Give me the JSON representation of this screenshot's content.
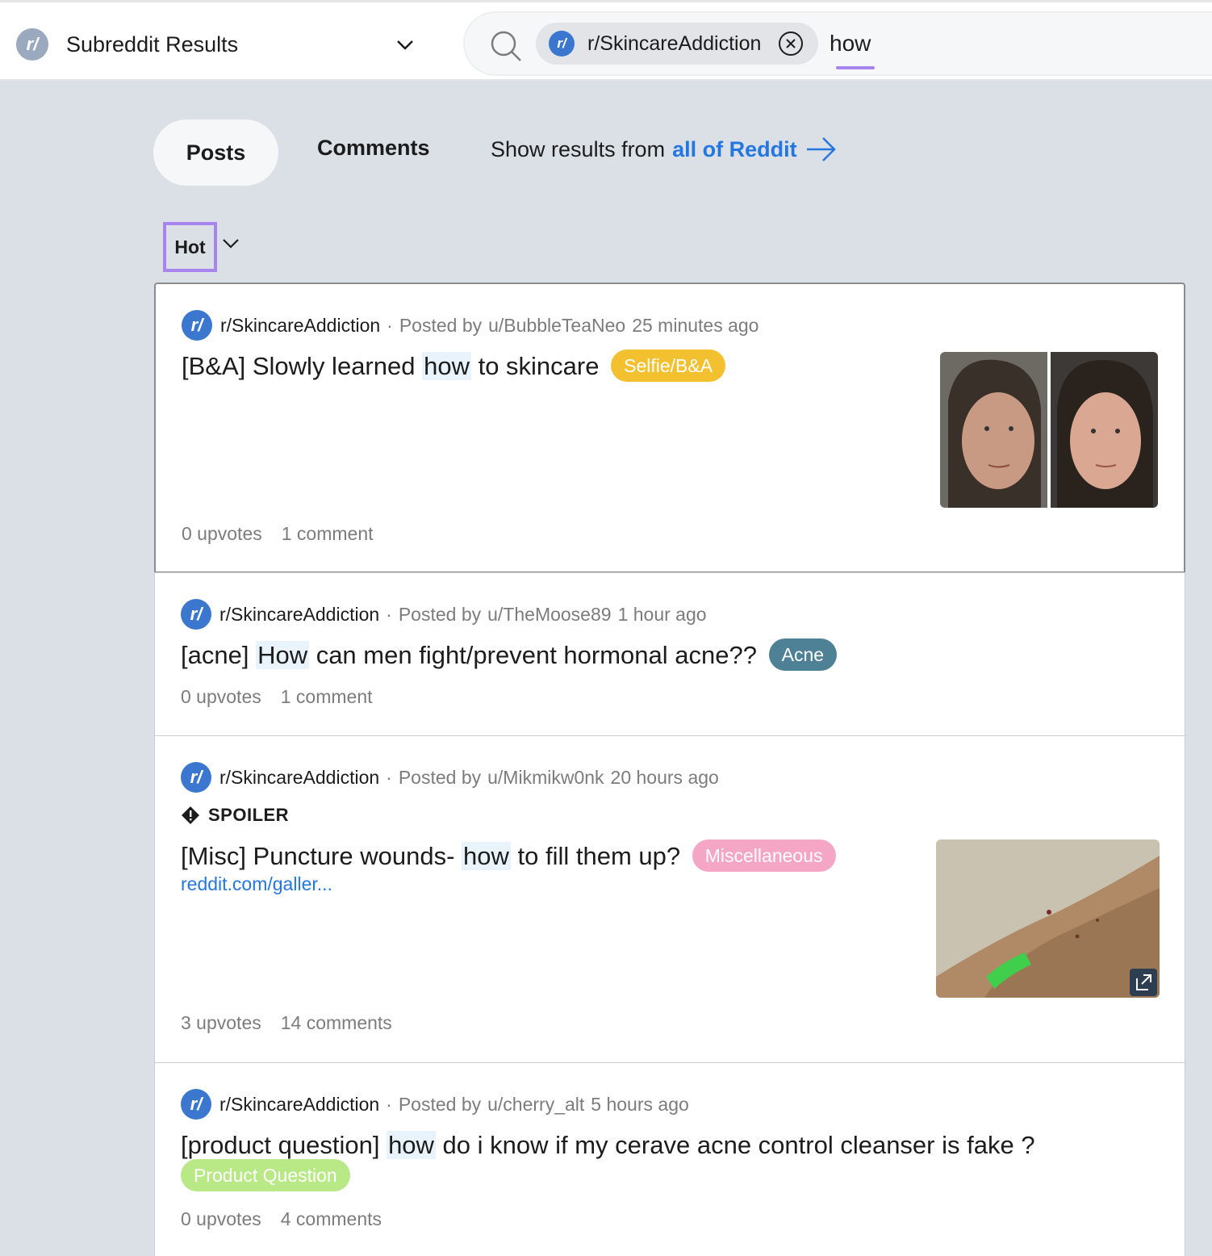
{
  "header": {
    "community_icon_text": "r/",
    "community_title": "Subreddit Results",
    "chip_icon_text": "r/",
    "chip_label": "r/SkincareAddiction",
    "search_value": "how"
  },
  "tabs": {
    "posts": "Posts",
    "comments": "Comments",
    "show_results_prefix": "Show results from",
    "show_results_link": "all of Reddit"
  },
  "sort": {
    "label": "Hot"
  },
  "posts": [
    {
      "subreddit": "r/SkincareAddiction",
      "posted_by": "Posted by",
      "user": "u/BubbleTeaNeo",
      "time": "25 minutes ago",
      "title_before": "[B&A] Slowly learned ",
      "title_highlight": "how",
      "title_after": " to skincare",
      "flair": "Selfie/B&A",
      "flair_bg": "#f3c12f",
      "flair_color": "#ffffff",
      "upvotes": "0 upvotes",
      "comments": "1 comment"
    },
    {
      "subreddit": "r/SkincareAddiction",
      "posted_by": "Posted by",
      "user": "u/TheMoose89",
      "time": "1 hour ago",
      "title_before": "[acne] ",
      "title_highlight": "How",
      "title_after": " can men fight/prevent hormonal acne??",
      "flair": "Acne",
      "flair_bg": "#4f8196",
      "flair_color": "#ffffff",
      "upvotes": "0 upvotes",
      "comments": "1 comment"
    },
    {
      "subreddit": "r/SkincareAddiction",
      "posted_by": "Posted by",
      "user": "u/Mikmikw0nk",
      "time": "20 hours ago",
      "spoiler": "SPOILER",
      "title_before": "[Misc] Puncture wounds- ",
      "title_highlight": "how",
      "title_after": " to fill them up?",
      "flair": "Miscellaneous",
      "flair_bg": "#f5a6c4",
      "flair_color": "#ffffff",
      "link": "reddit.com/galler...",
      "upvotes": "3 upvotes",
      "comments": "14 comments"
    },
    {
      "subreddit": "r/SkincareAddiction",
      "posted_by": "Posted by",
      "user": "u/cherry_alt",
      "time": "5 hours ago",
      "title_before": "[product question] ",
      "title_highlight": "how",
      "title_after": " do i know if my cerave acne control cleanser is fake ?",
      "flair": "Product Question",
      "flair_bg": "#b8e986",
      "flair_color": "#ffffff",
      "upvotes": "0 upvotes",
      "comments": "4 comments"
    }
  ],
  "colors": {
    "accent": "#a884ef",
    "link": "#2476e0",
    "background": "#dae0e6"
  }
}
